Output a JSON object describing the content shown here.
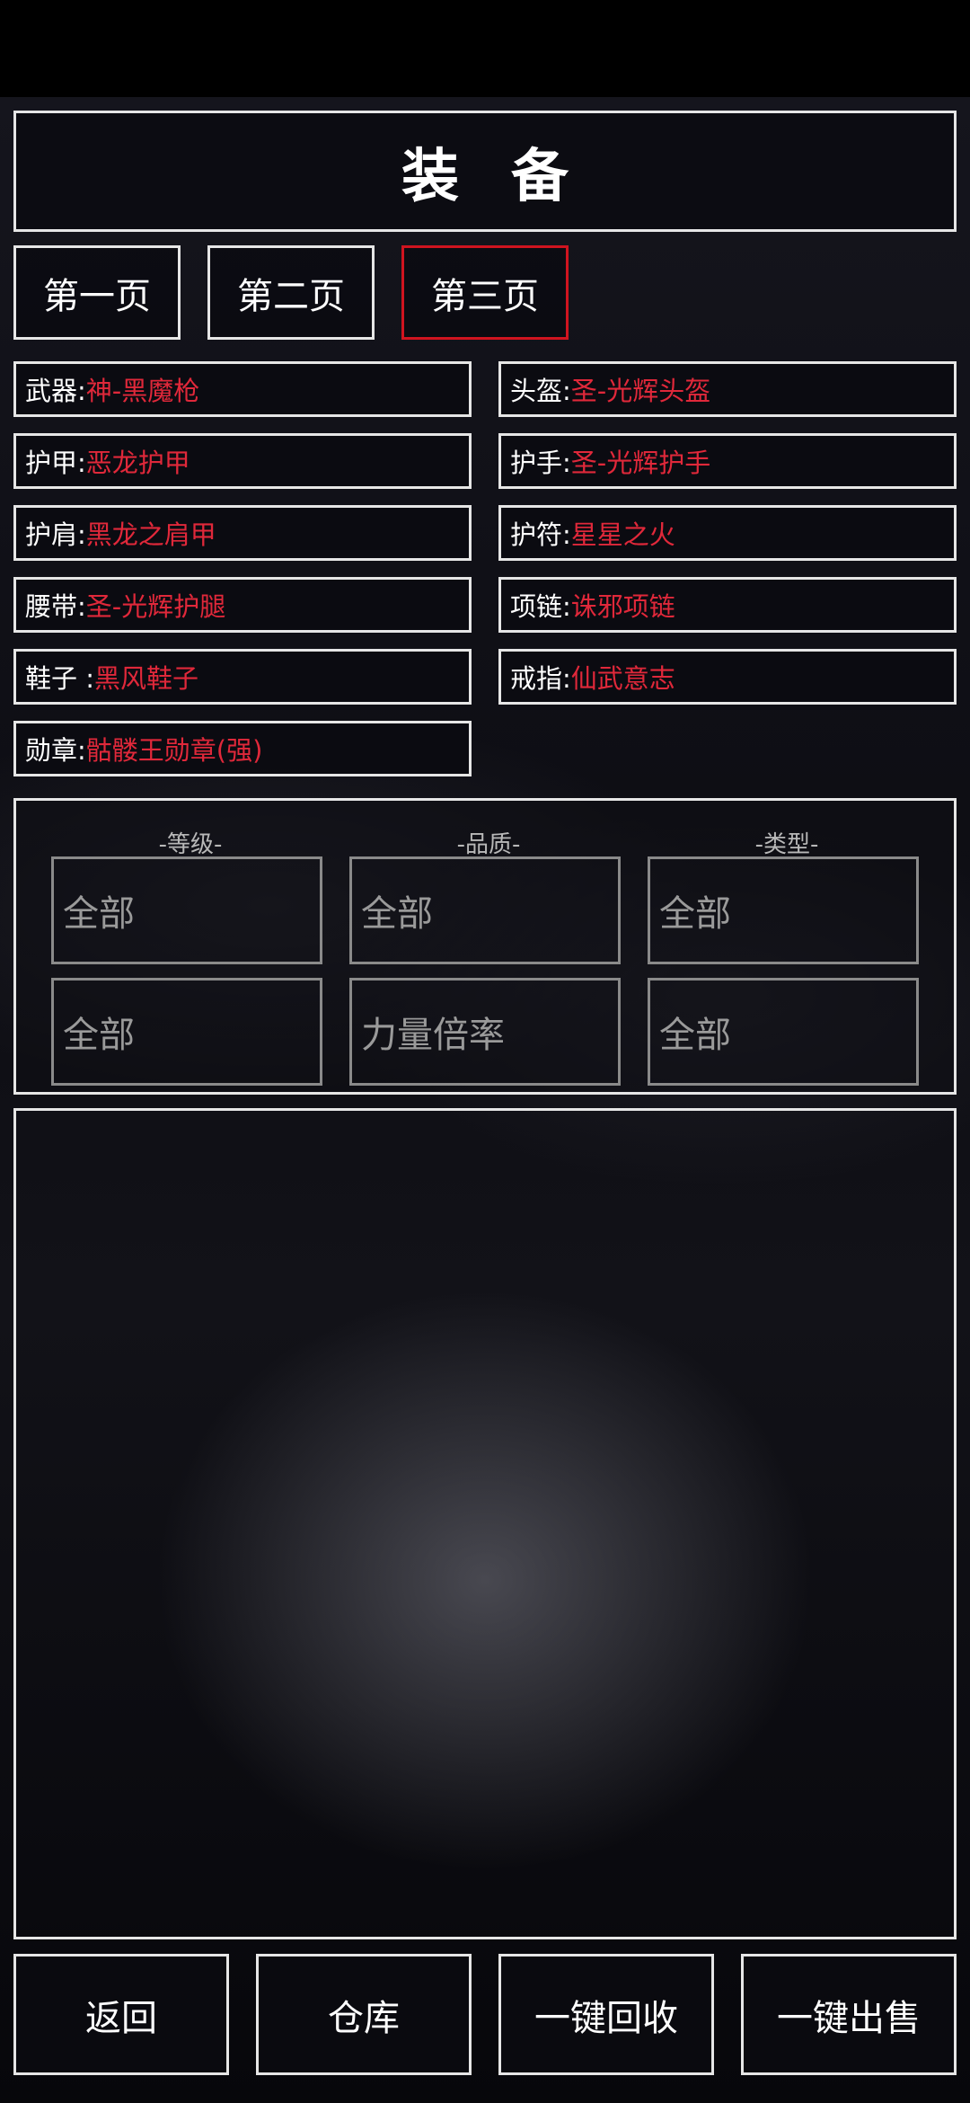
{
  "title": "装备",
  "pages": [
    "第一页",
    "第二页",
    "第三页"
  ],
  "active_page": 2,
  "slots": [
    {
      "key": "武器: ",
      "value": "神-黑魔枪"
    },
    {
      "key": "头盔: ",
      "value": "圣-光辉头盔"
    },
    {
      "key": "护甲: ",
      "value": "恶龙护甲"
    },
    {
      "key": "护手: ",
      "value": "圣-光辉护手"
    },
    {
      "key": "护肩: ",
      "value": "黑龙之肩甲"
    },
    {
      "key": "护符: ",
      "value": "星星之火"
    },
    {
      "key": "腰带: ",
      "value": "圣-光辉护腿"
    },
    {
      "key": "项链: ",
      "value": "诛邪项链"
    },
    {
      "key": "鞋子 :",
      "value": "黑风鞋子"
    },
    {
      "key": "戒指: ",
      "value": "仙武意志"
    },
    {
      "key": "勋章: ",
      "value": "骷髅王勋章(强)"
    }
  ],
  "filters": {
    "labels": [
      "-等级-",
      "-品质-",
      "-类型-"
    ],
    "row1": [
      "全部",
      "全部",
      "全部"
    ],
    "row2": [
      "全部",
      "力量倍率",
      "全部"
    ]
  },
  "bottom": [
    "返回",
    "仓库",
    "一键回收",
    "一键出售"
  ],
  "colors": {
    "accent": "#d0141f",
    "value_text": "#e0283a",
    "border": "#e6e6e6"
  }
}
